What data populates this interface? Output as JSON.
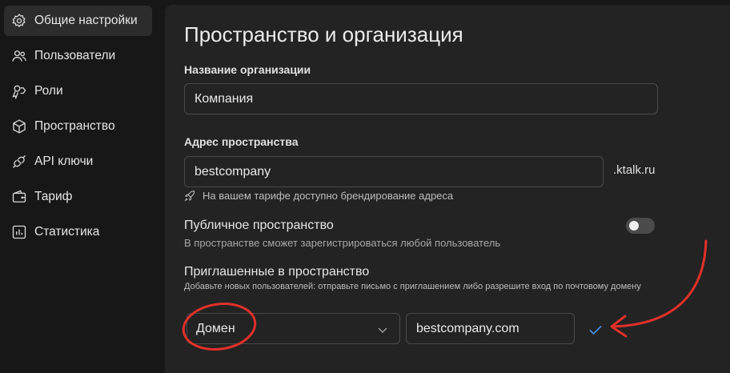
{
  "sidebar": {
    "items": [
      {
        "label": "Общие настройки",
        "icon": "gear-icon",
        "active": true
      },
      {
        "label": "Пользователи",
        "icon": "users-icon"
      },
      {
        "label": "Роли",
        "icon": "roles-icon"
      },
      {
        "label": "Пространство",
        "icon": "cube-icon"
      },
      {
        "label": "API ключи",
        "icon": "plug-icon"
      },
      {
        "label": "Тариф",
        "icon": "wallet-icon"
      },
      {
        "label": "Статистика",
        "icon": "chart-icon"
      }
    ]
  },
  "main": {
    "title": "Пространство и организация",
    "org_name": {
      "label": "Название организации",
      "value": "Компания"
    },
    "space_address": {
      "label": "Адрес пространства",
      "value": "bestcompany",
      "suffix": ".ktalk.ru",
      "hint": "На вашем тарифе доступно брендирование адреса"
    },
    "public_space": {
      "title": "Публичное пространство",
      "description": "В пространстве сможет зарегистрироваться любой пользователь",
      "enabled": false
    },
    "invited": {
      "title": "Приглашенные в пространство",
      "description": "Добавьте новых пользователей: отправьте письмо с приглашением либо разрешите вход по почтовому домену",
      "type_value": "Домен",
      "domain_value": "bestcompany.com"
    }
  },
  "colors": {
    "accent": "#4a90e2",
    "annotation": "#e2302a",
    "panel_bg": "#232323",
    "page_bg": "#171717"
  }
}
